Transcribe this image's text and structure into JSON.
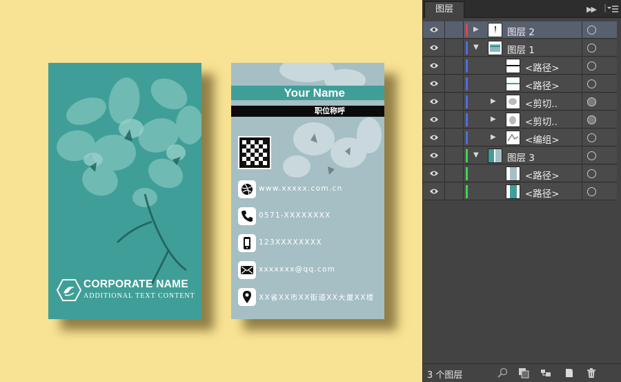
{
  "front_card": {
    "corp_name": "CORPORATE NAME",
    "corp_sub": "ADDITIONAL TEXT CONTENT",
    "color": "#3f9f98"
  },
  "back_card": {
    "name": "Your Name",
    "title": "职位称呼",
    "contacts": [
      {
        "icon": "dribbble-icon",
        "text": "www.xxxxx.com.cn"
      },
      {
        "icon": "phone-icon",
        "text": "0571-XXXXXXXX"
      },
      {
        "icon": "mobile-icon",
        "text": "123XXXXXXXX"
      },
      {
        "icon": "mail-icon",
        "text": "xxxxxxx@qq.com"
      },
      {
        "icon": "location-icon",
        "text": "XX省XX市XX街道XX大厦XX楼"
      }
    ],
    "color": "#a5bfc4"
  },
  "panel": {
    "tab": "图层",
    "layers": [
      {
        "label": "图层 2",
        "color": "#e04848"
      },
      {
        "label": "图层 1",
        "color": "#4c6fe0"
      },
      {
        "label": "<路径>",
        "color": "#4c6fe0"
      },
      {
        "label": "<路径>",
        "color": "#4c6fe0"
      },
      {
        "label": "<剪切..",
        "color": "#4c6fe0"
      },
      {
        "label": "<剪切..",
        "color": "#4c6fe0"
      },
      {
        "label": "<编组>",
        "color": "#4c6fe0"
      },
      {
        "label": "图层 3",
        "color": "#3fd64a"
      },
      {
        "label": "<路径>",
        "color": "#3fd64a"
      },
      {
        "label": "<路径>",
        "color": "#3fd64a"
      }
    ],
    "footer": "3 个图层"
  }
}
